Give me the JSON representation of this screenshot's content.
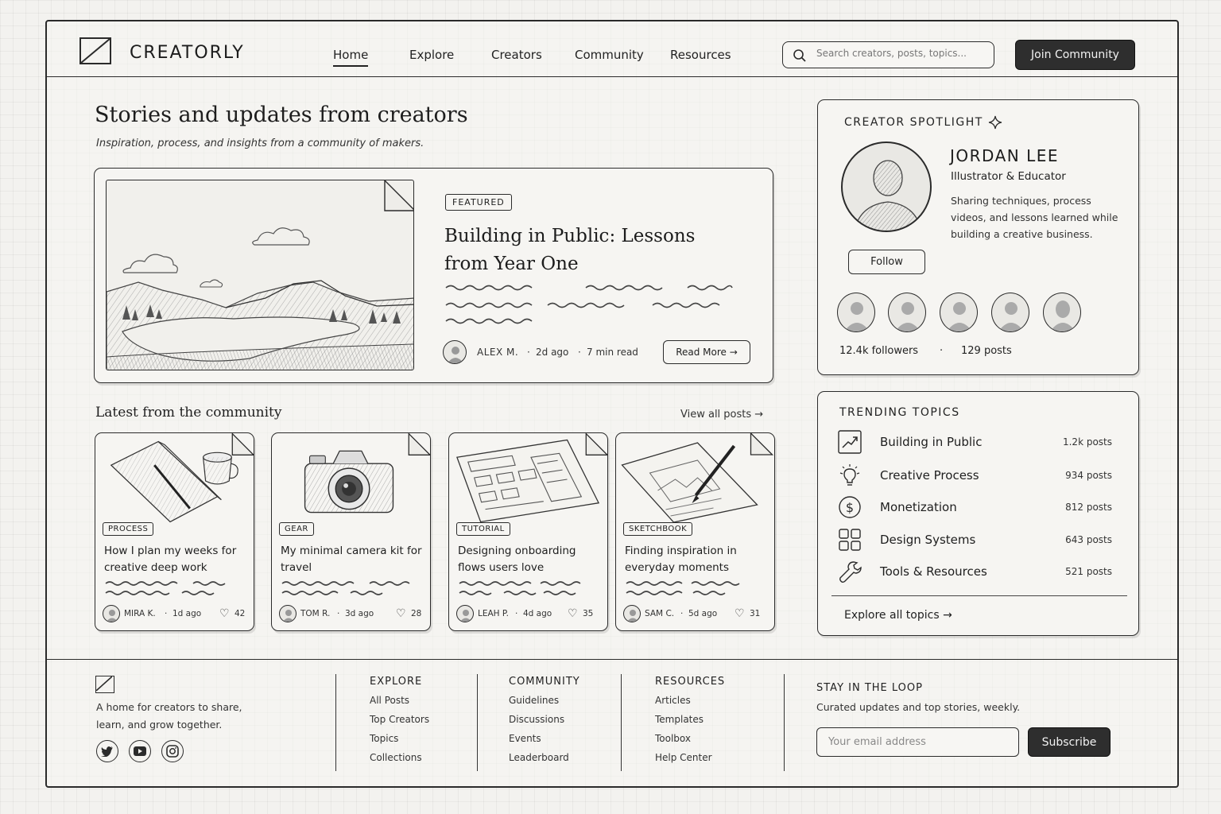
{
  "brand": {
    "name": "CREATORLY"
  },
  "nav": [
    {
      "label": "Home",
      "active": true
    },
    {
      "label": "Explore"
    },
    {
      "label": "Creators"
    },
    {
      "label": "Community"
    },
    {
      "label": "Resources"
    }
  ],
  "search": {
    "placeholder": "Search creators, posts, topics..."
  },
  "header": {
    "join_label": "Join Community"
  },
  "hero": {
    "title": "Stories and updates from creators",
    "subtitle": "Inspiration, process, and insights from a community of makers."
  },
  "featured": {
    "badge": "FEATURED",
    "title": "Building in Public: Lessons from Year One",
    "author": "ALEX M.",
    "time": "2d ago",
    "read_time": "7 min read",
    "read_label": "Read More →"
  },
  "latest": {
    "title": "Latest from the community",
    "view_all": "View all posts →",
    "posts": [
      {
        "tag": "PROCESS",
        "title": "How I plan my weeks for creative deep work",
        "author": "MIRA K.",
        "time": "1d ago",
        "likes": "42"
      },
      {
        "tag": "GEAR",
        "title": "My minimal camera kit for travel",
        "author": "TOM R.",
        "time": "3d ago",
        "likes": "28"
      },
      {
        "tag": "TUTORIAL",
        "title": "Designing onboarding flows users love",
        "author": "LEAH P.",
        "time": "4d ago",
        "likes": "35"
      },
      {
        "tag": "SKETCHBOOK",
        "title": "Finding inspiration in everyday moments",
        "author": "SAM C.",
        "time": "5d ago",
        "likes": "31"
      }
    ]
  },
  "spotlight": {
    "label": "CREATOR SPOTLIGHT",
    "name": "JORDAN LEE",
    "role": "Illustrator & Educator",
    "bio": "Sharing techniques, process videos, and lessons learned while building a creative business.",
    "follow_label": "Follow",
    "followers": "12.4k followers",
    "posts": "129 posts"
  },
  "trending": {
    "title": "TRENDING TOPICS",
    "topics": [
      {
        "name": "Building in Public",
        "count": "1.2k posts",
        "icon": "trend-chart-icon"
      },
      {
        "name": "Creative Process",
        "count": "934 posts",
        "icon": "lightbulb-icon"
      },
      {
        "name": "Monetization",
        "count": "812 posts",
        "icon": "dollar-icon"
      },
      {
        "name": "Design Systems",
        "count": "643 posts",
        "icon": "grid-icon"
      },
      {
        "name": "Tools & Resources",
        "count": "521 posts",
        "icon": "wrench-icon"
      }
    ],
    "explore_label": "Explore all topics →"
  },
  "footer": {
    "tagline": "A home for creators to share, learn, and grow together.",
    "columns": [
      {
        "title": "EXPLORE",
        "links": [
          "All Posts",
          "Top Creators",
          "Topics",
          "Collections"
        ]
      },
      {
        "title": "COMMUNITY",
        "links": [
          "Guidelines",
          "Discussions",
          "Events",
          "Leaderboard"
        ]
      },
      {
        "title": "RESOURCES",
        "links": [
          "Articles",
          "Templates",
          "Toolbox",
          "Help Center"
        ]
      }
    ],
    "newsletter": {
      "title": "STAY IN THE LOOP",
      "subtitle": "Curated updates and top stories, weekly.",
      "placeholder": "Your email address",
      "button": "Subscribe"
    }
  }
}
